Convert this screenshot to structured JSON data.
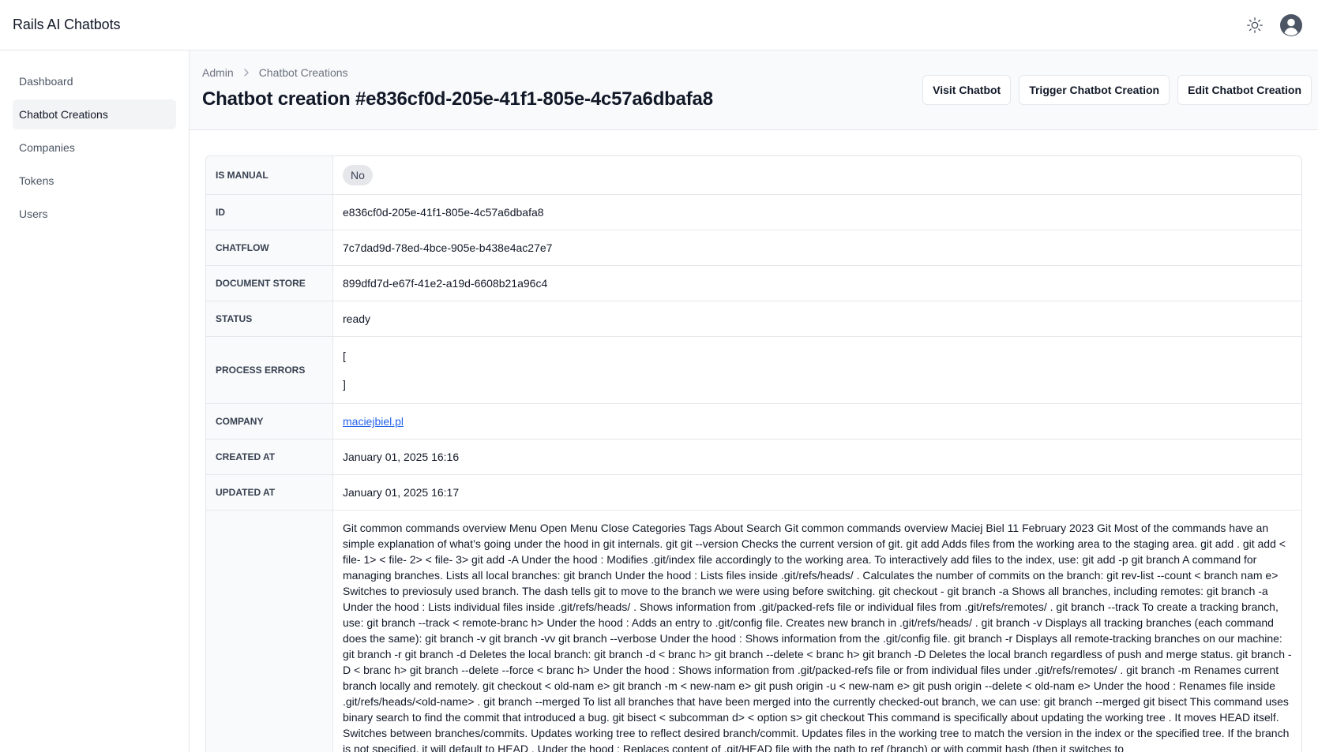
{
  "app": {
    "title": "Rails AI Chatbots"
  },
  "sidebar": {
    "items": [
      {
        "label": "Dashboard"
      },
      {
        "label": "Chatbot Creations"
      },
      {
        "label": "Companies"
      },
      {
        "label": "Tokens"
      },
      {
        "label": "Users"
      }
    ]
  },
  "breadcrumb": {
    "root": "Admin",
    "current": "Chatbot Creations"
  },
  "page": {
    "title": "Chatbot creation #e836cf0d-205e-41f1-805e-4c57a6dbafa8"
  },
  "actions": {
    "visit": "Visit Chatbot",
    "trigger": "Trigger Chatbot Creation",
    "edit": "Edit Chatbot Creation"
  },
  "details": {
    "is_manual": {
      "label": "IS MANUAL",
      "value": "No"
    },
    "id": {
      "label": "ID",
      "value": "e836cf0d-205e-41f1-805e-4c57a6dbafa8"
    },
    "chatflow": {
      "label": "CHATFLOW",
      "value": "7c7dad9d-78ed-4bce-905e-b438e4ac27e7"
    },
    "document_store": {
      "label": "DOCUMENT STORE",
      "value": "899dfd7d-e67f-41e2-a19d-6608b21a96c4"
    },
    "status": {
      "label": "STATUS",
      "value": "ready"
    },
    "process_errors": {
      "label": "PROCESS ERRORS",
      "open": "[",
      "close": "]"
    },
    "company": {
      "label": "COMPANY",
      "value": "maciejbiel.pl"
    },
    "created_at": {
      "label": "CREATED AT",
      "value": "January 01, 2025 16:16"
    },
    "updated_at": {
      "label": "UPDATED AT",
      "value": "January 01, 2025 16:17"
    },
    "content": {
      "label": "",
      "value": "Git common commands overview Menu Open Menu Close Categories Tags About Search Git common commands overview Maciej Biel 11 February 2023 Git Most of the commands have an simple explanation of what’s going under the hood in git internals. git git --version Checks the current version of git. git add Adds files from the working area to the staging area. git add . git add < file- 1> < file- 2> < file- 3> git add -A Under the hood : Modifies .git/index file accordingly to the working area. To interactively add files to the index, use: git add -p git branch A command for managing branches. Lists all local branches: git branch Under the hood : Lists files inside .git/refs/heads/ . Calculates the number of commits on the branch: git rev-list --count < branch nam e> Switches to previosuly used branch. The dash tells git to move to the branch we were using before switching. git checkout - git branch -a Shows all branches, including remotes: git branch -a Under the hood : Lists individual files inside .git/refs/heads/ . Shows information from .git/packed-refs file or individual files from .git/refs/remotes/ . git branch --track To create a tracking branch, use: git branch --track < remote-branc h> Under the hood : Adds an entry to .git/config file. Creates new branch in .git/refs/heads/ . git branch -v Displays all tracking branches (each command does the same): git branch -v git branch -vv git branch --verbose Under the hood : Shows information from the .git/config file. git branch -r Displays all remote-tracking branches on our machine: git branch -r git branch -d Deletes the local branch: git branch -d < branc h> git branch --delete < branc h> git branch -D Deletes the local branch regardless of push and merge status. git branch -D < branc h> git branch --delete --force < branc h> Under the hood : Shows information from .git/packed-refs file or from individual files under .git/refs/remotes/ . git branch -m Renames current branch locally and remotely. git checkout < old-nam e> git branch -m < new-nam e> git push origin -u < new-nam e> git push origin --delete < old-nam e> Under the hood : Renames file inside .git/refs/heads/<old-name> . git branch --merged To list all branches that have been merged into the currently checked-out branch, we can use: git branch --merged git bisect This command uses binary search to find the commit that introduced a bug. git bisect < subcomman d> < option s> git checkout This command is specifically about updating the working tree . It moves HEAD itself. Switches between branches/commits. Updates working tree to reflect desired branch/commit. Updates files in the working tree to match the version in the index or the specified tree. If the branch is not specified, it will default to HEAD . Under the hood : Replaces content of .git/HEAD file with the path to ref (branch) or with commit hash (then it switches to"
    }
  }
}
